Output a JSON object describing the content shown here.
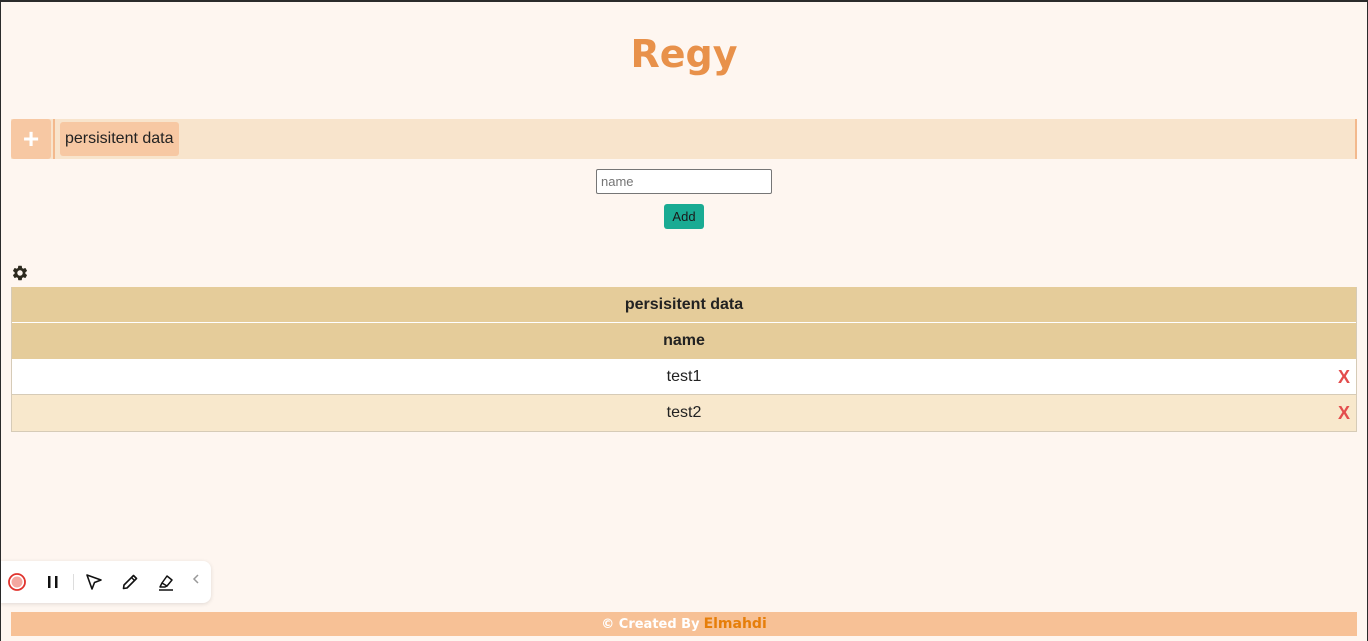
{
  "app": {
    "title": "Regy"
  },
  "tabs": {
    "add_label": "+",
    "items": [
      {
        "label": "persisitent data"
      }
    ]
  },
  "form": {
    "name_placeholder": "name",
    "name_value": "",
    "add_label": "Add"
  },
  "table": {
    "title": "persisitent data",
    "columns": [
      "name"
    ],
    "rows": [
      {
        "name": "test1",
        "delete_label": "X"
      },
      {
        "name": "test2",
        "delete_label": "X"
      }
    ]
  },
  "footer": {
    "prefix": "© Created By",
    "author": "Elmahdi"
  },
  "toolbar": {
    "icons": [
      "record-icon",
      "pause-icon",
      "cursor-icon",
      "pen-icon",
      "highlighter-icon",
      "chevron-left-icon"
    ]
  },
  "colors": {
    "accent": "#e8914a",
    "button": "#1aab93",
    "header_bg": "#e5cc9a",
    "tabbar_bg": "#f8e4cc",
    "delete": "#e34d4d"
  }
}
